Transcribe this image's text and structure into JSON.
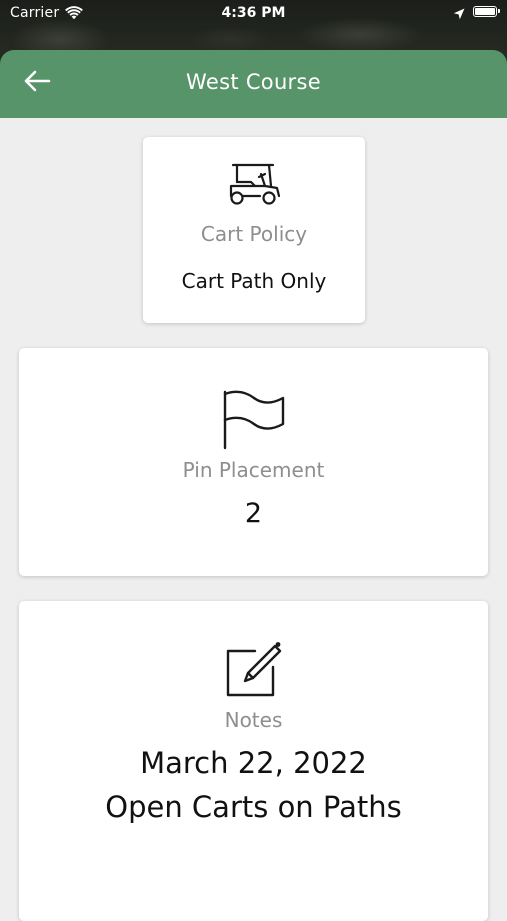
{
  "status_bar": {
    "carrier": "Carrier",
    "time": "4:36 PM",
    "wifi_icon": "wifi-icon",
    "location_icon": "location-arrow-icon",
    "battery_icon": "battery-icon"
  },
  "header": {
    "title": "West Course",
    "back_icon": "arrow-left-icon",
    "background_color": "#579469"
  },
  "cards": {
    "cart_policy": {
      "icon": "golf-cart-icon",
      "label": "Cart Policy",
      "value": "Cart Path Only"
    },
    "pin_placement": {
      "icon": "flag-icon",
      "label": "Pin Placement",
      "value": "2"
    },
    "notes": {
      "icon": "edit-note-icon",
      "label": "Notes",
      "line1": "March 22, 2022",
      "line2": "Open Carts on Paths"
    }
  },
  "colors": {
    "page_background": "#efeeef",
    "card_background": "#ffffff",
    "label_gray": "#8e8e8e"
  }
}
